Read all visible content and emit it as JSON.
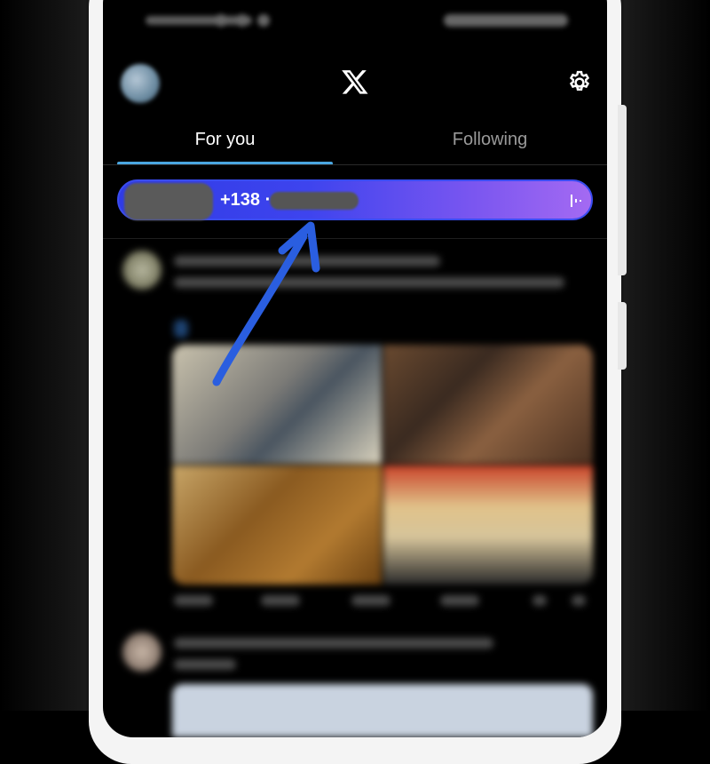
{
  "tabs": {
    "for_you": "For you",
    "following": "Following"
  },
  "pill": {
    "count_text": "+138 ·"
  },
  "colors": {
    "tab_underline": "#4aa6e0",
    "pill_start": "#2f3be6",
    "pill_end": "#a46af2",
    "annotation_arrow": "#2a5ee0"
  },
  "icons": {
    "logo": "x-logo-icon",
    "settings": "gear-icon",
    "pill_action": "waveform-icon"
  }
}
